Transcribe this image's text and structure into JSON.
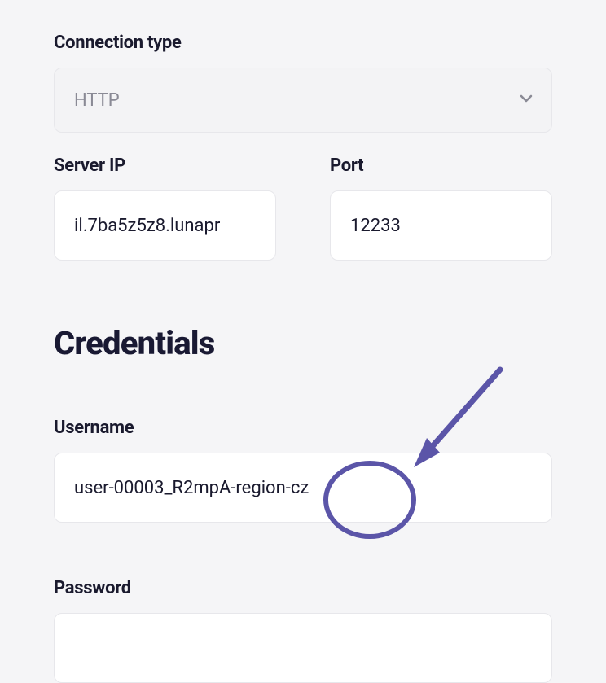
{
  "connection": {
    "type_label": "Connection type",
    "type_value": "HTTP",
    "server_ip_label": "Server IP",
    "server_ip_value": "il.7ba5z5z8.lunapr",
    "port_label": "Port",
    "port_value": "12233"
  },
  "credentials": {
    "heading": "Credentials",
    "username_label": "Username",
    "username_value": "user-00003_R2mpA-region-cz",
    "password_label": "Password",
    "password_value": ""
  }
}
